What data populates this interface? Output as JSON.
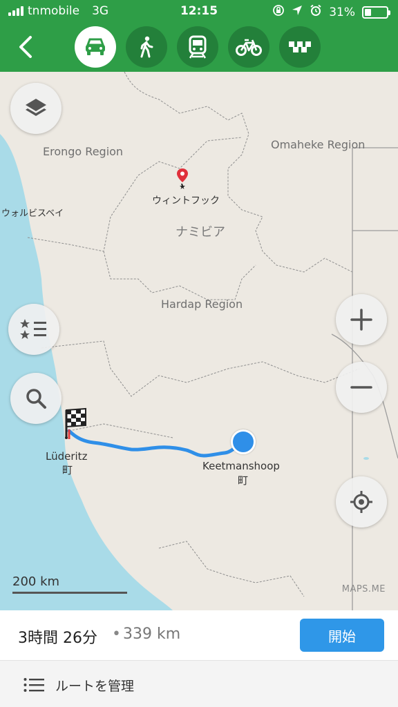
{
  "status_bar": {
    "carrier": "tnmobile",
    "network": "3G",
    "time": "12:15",
    "battery": "31%",
    "battery_level": 0.31
  },
  "transport_modes": {
    "selected": "car",
    "items": [
      "car-icon",
      "pedestrian-icon",
      "train-icon",
      "bicycle-icon",
      "taxi-icon"
    ]
  },
  "map": {
    "region_labels": {
      "erongo": "Erongo Region",
      "omaheke": "Omaheke Region",
      "hardap": "Hardap Region"
    },
    "place_labels": {
      "windhoek": "ウィントフック",
      "walvis_bay": "ウォルビスベイ",
      "namibia": "ナミビア"
    },
    "route": {
      "destination_name": "Lüderitz",
      "destination_type": "町",
      "origin_name": "Keetmanshoop",
      "origin_type": "町"
    },
    "scale_label": "200 km",
    "brand": "MAPS.ME",
    "colors": {
      "route": "#2f8fe8",
      "water": "#a9dbe8",
      "land": "#ede9e2",
      "border": "#8e8e8e",
      "accent": "#2e9e47"
    }
  },
  "route_summary": {
    "duration": "3時間 26分",
    "separator": "•",
    "distance": "339 km",
    "start_label": "開始"
  },
  "manage_route_label": "ルートを管理"
}
